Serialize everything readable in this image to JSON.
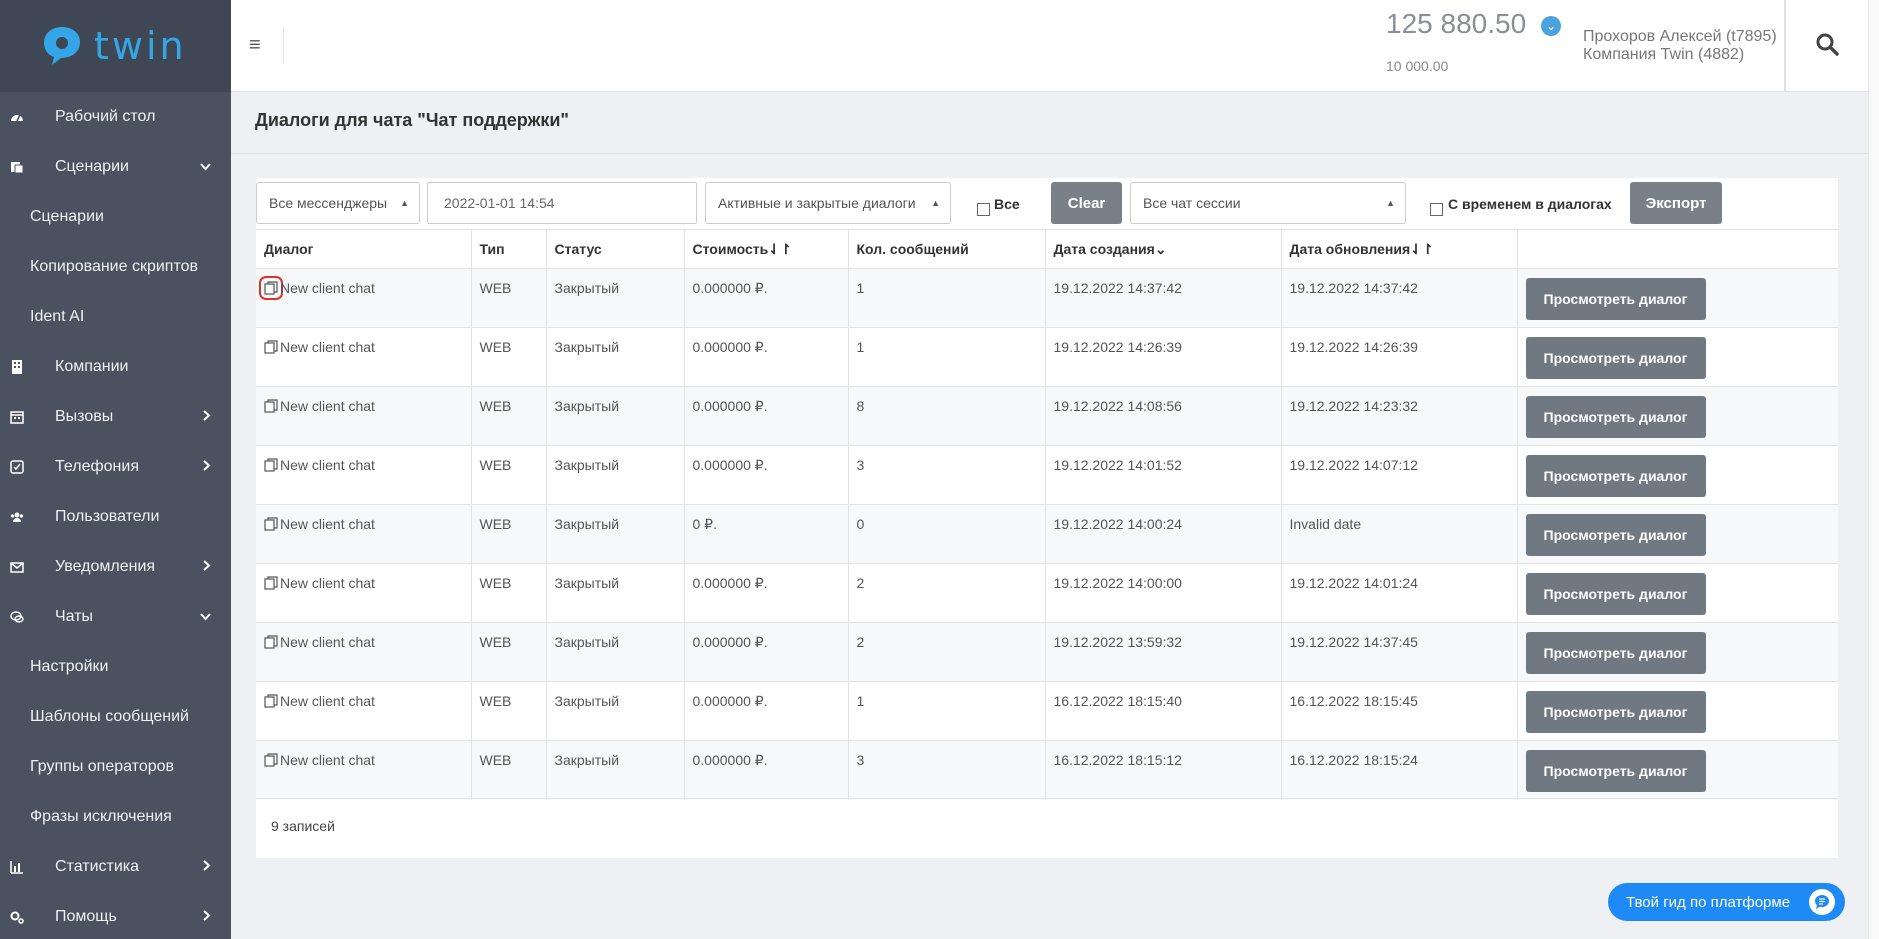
{
  "brand": {
    "name": "twin",
    "color": "#34a6e8"
  },
  "sidebar": {
    "items": [
      {
        "label": "Рабочий стол",
        "icon": "dashboard-icon",
        "type": "main",
        "arrow": ""
      },
      {
        "label": "Сценарии",
        "icon": "scenarios-icon",
        "type": "main",
        "arrow": "expanded"
      },
      {
        "label": "Сценарии",
        "icon": "",
        "type": "sub",
        "arrow": ""
      },
      {
        "label": "Копирование скриптов",
        "icon": "",
        "type": "sub",
        "arrow": ""
      },
      {
        "label": "Ident AI",
        "icon": "",
        "type": "sub",
        "arrow": ""
      },
      {
        "label": "Компании",
        "icon": "building-icon",
        "type": "main",
        "arrow": ""
      },
      {
        "label": "Вызовы",
        "icon": "calendar-icon",
        "type": "main",
        "arrow": "collapsed"
      },
      {
        "label": "Телефония",
        "icon": "telephony-icon",
        "type": "main",
        "arrow": "collapsed"
      },
      {
        "label": "Пользователи",
        "icon": "users-icon",
        "type": "main",
        "arrow": ""
      },
      {
        "label": "Уведомления",
        "icon": "envelope-icon",
        "type": "main",
        "arrow": "collapsed"
      },
      {
        "label": "Чаты",
        "icon": "chats-icon",
        "type": "main",
        "arrow": "expanded"
      },
      {
        "label": "Настройки",
        "icon": "",
        "type": "sub",
        "arrow": ""
      },
      {
        "label": "Шаблоны сообщений",
        "icon": "",
        "type": "sub",
        "arrow": ""
      },
      {
        "label": "Группы операторов",
        "icon": "",
        "type": "sub",
        "arrow": ""
      },
      {
        "label": "Фразы исключения",
        "icon": "",
        "type": "sub",
        "arrow": ""
      },
      {
        "label": "Статистика",
        "icon": "bar-chart-icon",
        "type": "main",
        "arrow": "collapsed"
      },
      {
        "label": "Помощь",
        "icon": "help-cogs-icon",
        "type": "main",
        "arrow": "collapsed"
      }
    ]
  },
  "header": {
    "balance": "125 880.50",
    "credit": "10 000.00",
    "user": "Прохоров Алексей (t7895)",
    "company": "Компания Twin (4882)"
  },
  "page": {
    "title": "Диалоги для чата \"Чат поддержки\""
  },
  "filters": {
    "messengers": "Все мессенджеры",
    "date": "2022-01-01 14:54",
    "dialog_status": "Активные и закрытые диалоги",
    "all_label": "Все",
    "clear_label": "Clear",
    "sessions": "Все чат сессии",
    "with_time_label": "С временем в диалогах",
    "export_label": "Экспорт"
  },
  "table": {
    "columns": [
      "Диалог",
      "Тип",
      "Статус",
      "Стоимость⇃↾",
      "Кол. сообщений",
      "Дата создания",
      "Дата обновления⇃↾",
      ""
    ],
    "sort_icons": {
      "created": "⌄"
    },
    "view_label": "Просмотреть диалог",
    "rows": [
      {
        "dialog": "New client chat",
        "type": "WEB",
        "status": "Закрытый",
        "cost": "0.000000 ₽.",
        "messages": "1",
        "created": "19.12.2022 14:37:42",
        "updated": "19.12.2022 14:37:42"
      },
      {
        "dialog": "New client chat",
        "type": "WEB",
        "status": "Закрытый",
        "cost": "0.000000 ₽.",
        "messages": "1",
        "created": "19.12.2022 14:26:39",
        "updated": "19.12.2022 14:26:39"
      },
      {
        "dialog": "New client chat",
        "type": "WEB",
        "status": "Закрытый",
        "cost": "0.000000 ₽.",
        "messages": "8",
        "created": "19.12.2022 14:08:56",
        "updated": "19.12.2022 14:23:32"
      },
      {
        "dialog": "New client chat",
        "type": "WEB",
        "status": "Закрытый",
        "cost": "0.000000 ₽.",
        "messages": "3",
        "created": "19.12.2022 14:01:52",
        "updated": "19.12.2022 14:07:12"
      },
      {
        "dialog": "New client chat",
        "type": "WEB",
        "status": "Закрытый",
        "cost": "0 ₽.",
        "messages": "0",
        "created": "19.12.2022 14:00:24",
        "updated": "Invalid date"
      },
      {
        "dialog": "New client chat",
        "type": "WEB",
        "status": "Закрытый",
        "cost": "0.000000 ₽.",
        "messages": "2",
        "created": "19.12.2022 14:00:00",
        "updated": "19.12.2022 14:01:24"
      },
      {
        "dialog": "New client chat",
        "type": "WEB",
        "status": "Закрытый",
        "cost": "0.000000 ₽.",
        "messages": "2",
        "created": "19.12.2022 13:59:32",
        "updated": "19.12.2022 14:37:45"
      },
      {
        "dialog": "New client chat",
        "type": "WEB",
        "status": "Закрытый",
        "cost": "0.000000 ₽.",
        "messages": "1",
        "created": "16.12.2022 18:15:40",
        "updated": "16.12.2022 18:15:45"
      },
      {
        "dialog": "New client chat",
        "type": "WEB",
        "status": "Закрытый",
        "cost": "0.000000 ₽.",
        "messages": "3",
        "created": "16.12.2022 18:15:12",
        "updated": "16.12.2022 18:15:24"
      }
    ],
    "footer": "9 записей"
  },
  "guide": {
    "label": "Твой гид по платформе"
  },
  "colors": {
    "sidebar": "#4a5260",
    "button_gray": "#707881",
    "guide_blue": "#1e8af6",
    "highlight": "#e0322b"
  }
}
